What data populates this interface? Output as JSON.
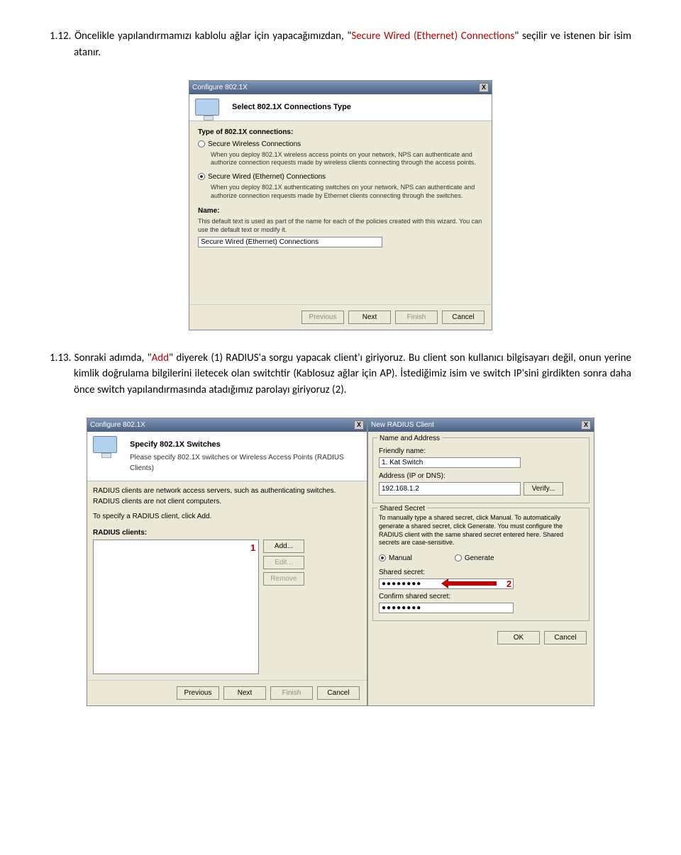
{
  "para1": {
    "num": "1.12.",
    "text_a": "Öncelikle yapılandırmamızı kablolu ağlar için yapacağımızdan, \"",
    "red": "Secure Wired (Ethernet) Connections",
    "text_b": "\" seçilir ve istenen bir isim atanır."
  },
  "para2": {
    "num": "1.13.",
    "text_a": "Sonraki adımda, \"",
    "red": "Add",
    "text_b": "\" diyerek (1) RADIUS'a sorgu yapacak client'ı giriyoruz. Bu client son kullanıcı bilgisayarı değil, onun yerine kimlik doğrulama bilgilerini iletecek olan switchtir (Kablosuz ağlar için AP). İstediğimiz isim ve switch IP'sini girdikten sonra daha önce switch yapılandırmasında atadığımız parolayı giriyoruz (2)."
  },
  "dialog1": {
    "title": "Configure 802.1X",
    "close": "X",
    "banner_title": "Select 802.1X Connections Type",
    "type_label": "Type of 802.1X connections:",
    "opt1_label": "Secure Wireless Connections",
    "opt1_desc": "When you deploy 802.1X wireless access points on your network, NPS can authenticate and authorize connection requests made by wireless clients connecting through the access points.",
    "opt2_label": "Secure Wired (Ethernet) Connections",
    "opt2_desc": "When you deploy 802.1X authenticating switches on your network, NPS can authenticate and authorize connection requests made by Ethernet clients connecting through the switches.",
    "name_label": "Name:",
    "name_desc": "This default text is used as part of the name for each of the policies created with this wizard. You can use the default text or modify it.",
    "name_value": "Secure Wired (Ethernet) Connections",
    "buttons": {
      "previous": "Previous",
      "next": "Next",
      "finish": "Finish",
      "cancel": "Cancel"
    }
  },
  "dialog2a": {
    "title": "Configure 802.1X",
    "close": "X",
    "banner_title": "Specify 802.1X Switches",
    "banner_sub": "Please specify 802.1X switches or Wireless Access Points (RADIUS Clients)",
    "intro1": "RADIUS clients are network access servers, such as authenticating switches. RADIUS clients are not client computers.",
    "intro2": "To specify a RADIUS client, click Add.",
    "list_label": "RADIUS clients:",
    "add": "Add...",
    "edit": "Edit...",
    "remove": "Remove",
    "buttons": {
      "previous": "Previous",
      "next": "Next",
      "finish": "Finish",
      "cancel": "Cancel"
    },
    "tag1": "1"
  },
  "dialog2b": {
    "title": "New RADIUS Client",
    "close": "X",
    "group_name": "Name and Address",
    "friendly_label": "Friendly name:",
    "friendly_value": "1. Kat Switch",
    "address_label": "Address (IP or DNS):",
    "address_value": "192.168.1.2",
    "verify": "Verify...",
    "group_secret": "Shared Secret",
    "secret_desc": "To manually type a shared secret, click Manual. To automatically generate a shared secret, click Generate. You must configure the RADIUS client with the same shared secret entered here. Shared secrets are case-sensitive.",
    "manual": "Manual",
    "generate": "Generate",
    "shared_label": "Shared secret:",
    "shared_value": "●●●●●●●●",
    "confirm_label": "Confirm shared secret:",
    "confirm_value": "●●●●●●●●",
    "ok": "OK",
    "cancel": "Cancel",
    "tag2": "2"
  }
}
